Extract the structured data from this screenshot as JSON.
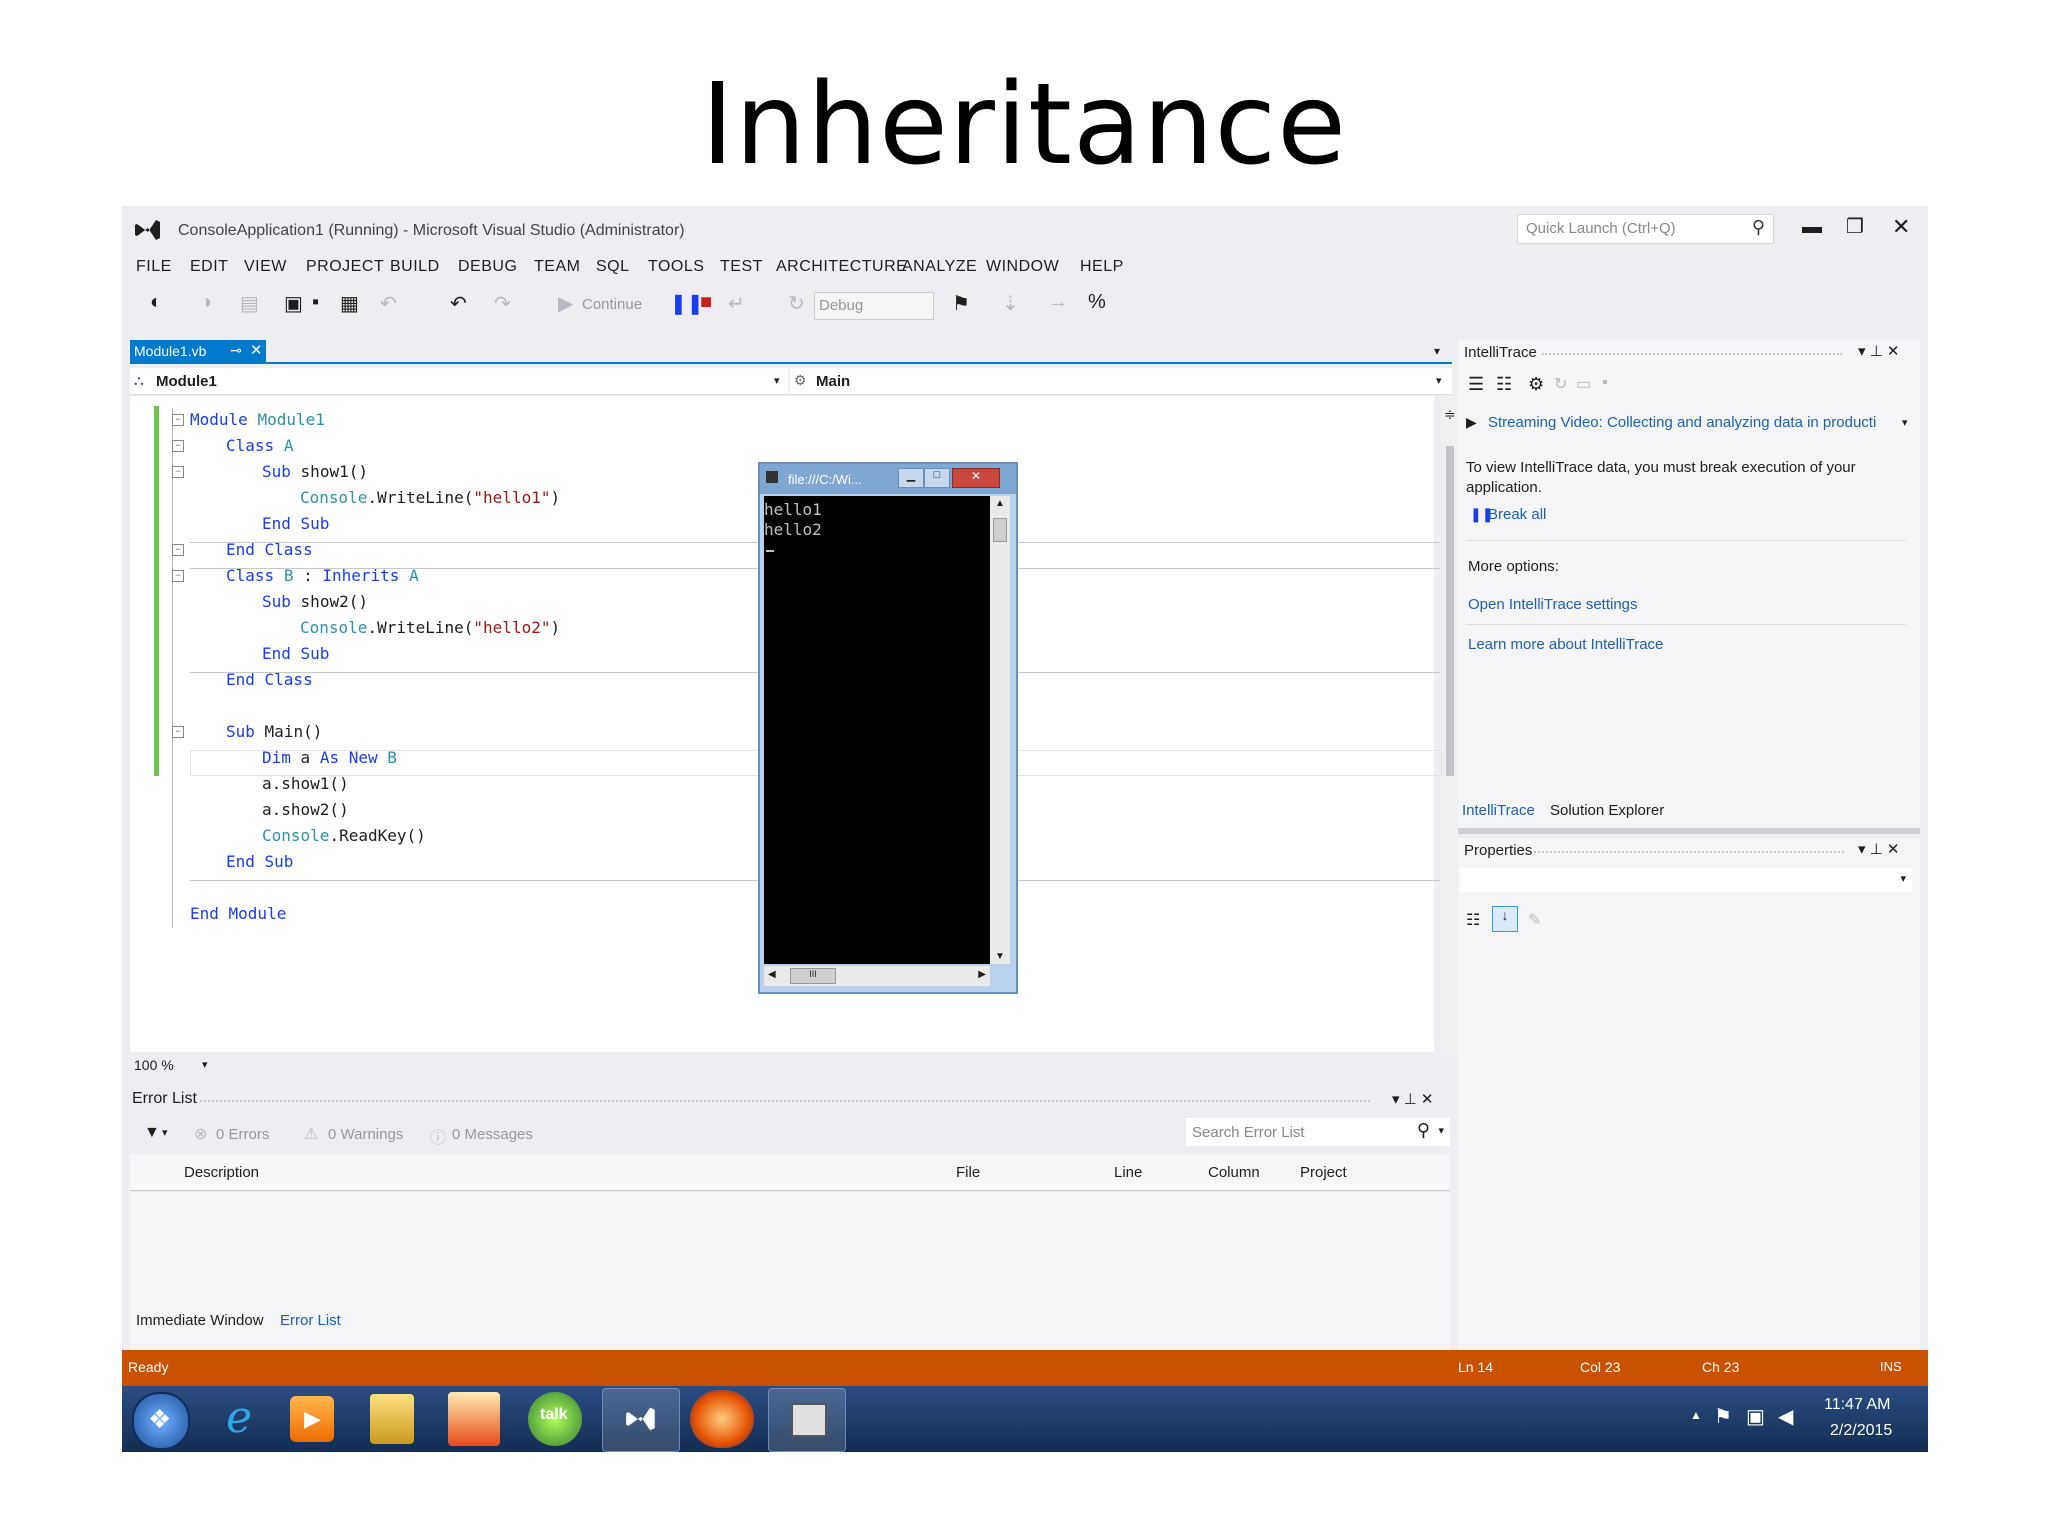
{
  "slide": {
    "title": "Inheritance"
  },
  "vs": {
    "window_title": "ConsoleApplication1 (Running) - Microsoft Visual Studio (Administrator)",
    "quick_launch_placeholder": "Quick Launch (Ctrl+Q)",
    "menu": [
      "FILE",
      "EDIT",
      "VIEW",
      "PROJECT",
      "BUILD",
      "DEBUG",
      "TEAM",
      "SQL",
      "TOOLS",
      "TEST",
      "ARCHITECTURE",
      "ANALYZE",
      "WINDOW",
      "HELP"
    ],
    "toolbar": {
      "continue_label": "Continue",
      "config_value": "Debug"
    },
    "editor": {
      "tab_label": "Module1.vb",
      "nav_left": "Module1",
      "nav_right": "Main",
      "zoom": "100 %",
      "code": {
        "l1a": "Module",
        "l1b": "Module1",
        "l2a": "Class",
        "l2b": "A",
        "l3a": "Sub",
        "l3b": "show1()",
        "l4a": "Console",
        "l4b": ".WriteLine(",
        "l4c": "\"hello1\"",
        "l4d": ")",
        "l5a": "End Sub",
        "l6a": "End Class",
        "l7a": "Class",
        "l7b": "B",
        "l7c": " : ",
        "l7d": "Inherits",
        "l7e": "A",
        "l8a": "Sub",
        "l8b": "show2()",
        "l9a": "Console",
        "l9b": ".WriteLine(",
        "l9c": "\"hello2\"",
        "l9d": ")",
        "l10a": "End Sub",
        "l11a": "End Class",
        "l12a": "Sub",
        "l12b": "Main()",
        "l13a": "Dim",
        "l13b": "a",
        "l13c": "As",
        "l13d": "New",
        "l13e": "B",
        "l14a": "a.show1()",
        "l15a": "a.show2()",
        "l16a": "Console",
        "l16b": ".ReadKey()",
        "l17a": "End Sub",
        "l18a": "End Module"
      }
    },
    "console": {
      "title": "file:///C:/Wi...",
      "line1": "hello1",
      "line2": "hello2",
      "scroll_label": "III"
    },
    "intellitrace": {
      "title": "IntelliTrace",
      "video_link": "Streaming Video: Collecting and analyzing data in producti",
      "info": "To view IntelliTrace data, you must break execution of your application.",
      "break_all": "Break all",
      "more_options": "More options:",
      "settings_link": "Open IntelliTrace settings",
      "learn_link": "Learn more about IntelliTrace",
      "tab1": "IntelliTrace",
      "tab2": "Solution Explorer"
    },
    "properties": {
      "title": "Properties"
    },
    "error_list": {
      "title": "Error List",
      "errors": "0 Errors",
      "warnings": "0 Warnings",
      "messages": "0 Messages",
      "search_placeholder": "Search Error List",
      "columns": [
        "Description",
        "File",
        "Line",
        "Column",
        "Project"
      ],
      "tab1": "Immediate Window",
      "tab2": "Error List"
    },
    "status": {
      "ready": "Ready",
      "ln": "Ln 14",
      "col": "Col 23",
      "ch": "Ch 23",
      "mode": "INS"
    }
  },
  "taskbar": {
    "time": "11:47 AM",
    "date": "2/2/2015",
    "accent": "#1f3f74"
  },
  "colors": {
    "accent": "#007acc",
    "status_bar": "#ca5100",
    "window_bg": "#eeeef2"
  }
}
